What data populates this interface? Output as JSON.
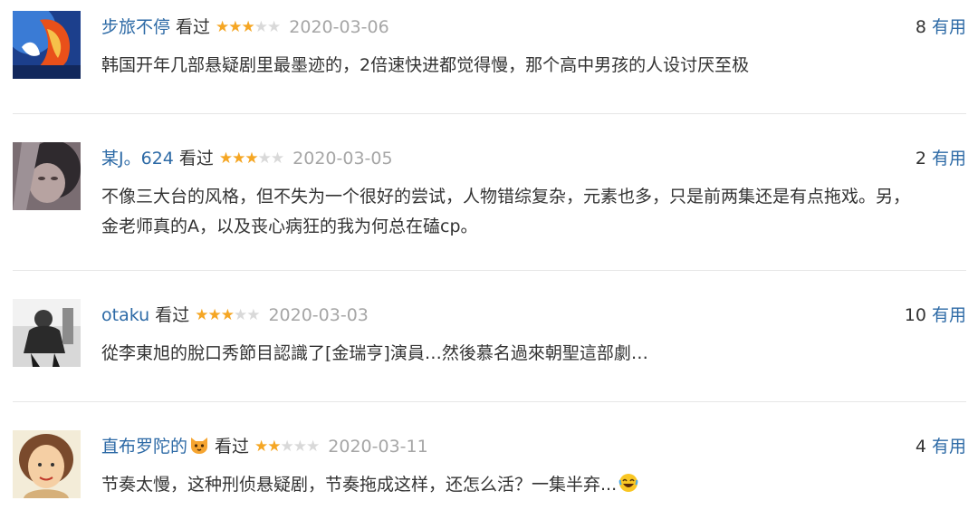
{
  "reviews": [
    {
      "user": "步旅不停",
      "user_emoji": "",
      "status": "看过",
      "stars": 3,
      "date": "2020-03-06",
      "useful_count": "8",
      "useful_label": "有用",
      "comment_lines": [
        "韩国开年几部悬疑剧里最墨迹的，2倍速快进都觉得慢，那个高中男孩的人设讨厌至极"
      ],
      "comment_emoji": ""
    },
    {
      "user": "某J。624",
      "user_emoji": "",
      "status": "看过",
      "stars": 3,
      "date": "2020-03-05",
      "useful_count": "2",
      "useful_label": "有用",
      "comment_lines": [
        "不像三大台的风格，但不失为一个很好的尝试，人物错综复杂，元素也多，只是前两集还是有点拖戏。另，",
        "金老师真的A，以及丧心病狂的我为何总在磕cp。"
      ],
      "comment_emoji": ""
    },
    {
      "user": "otaku",
      "user_emoji": "",
      "status": "看过",
      "stars": 3,
      "date": "2020-03-03",
      "useful_count": "10",
      "useful_label": "有用",
      "comment_lines": [
        "從李東旭的脫口秀節目認識了[金瑞亨]演員…然後慕名過來朝聖這部劇…"
      ],
      "comment_emoji": ""
    },
    {
      "user": "直布罗陀的",
      "user_emoji": "cat-face",
      "status": "看过",
      "stars": 2,
      "date": "2020-03-11",
      "useful_count": "4",
      "useful_label": "有用",
      "comment_lines": [
        "节奏太慢，这种刑侦悬疑剧，节奏拖成这样，还怎么活？一集半弃..."
      ],
      "comment_emoji": "laughing-face"
    }
  ],
  "colors": {
    "link": "#2d6aa6",
    "text": "#333333",
    "date": "#a6a6a6",
    "star_on": "#f5a623",
    "star_off": "#d9d9d9",
    "divider": "#e6e6e6"
  }
}
